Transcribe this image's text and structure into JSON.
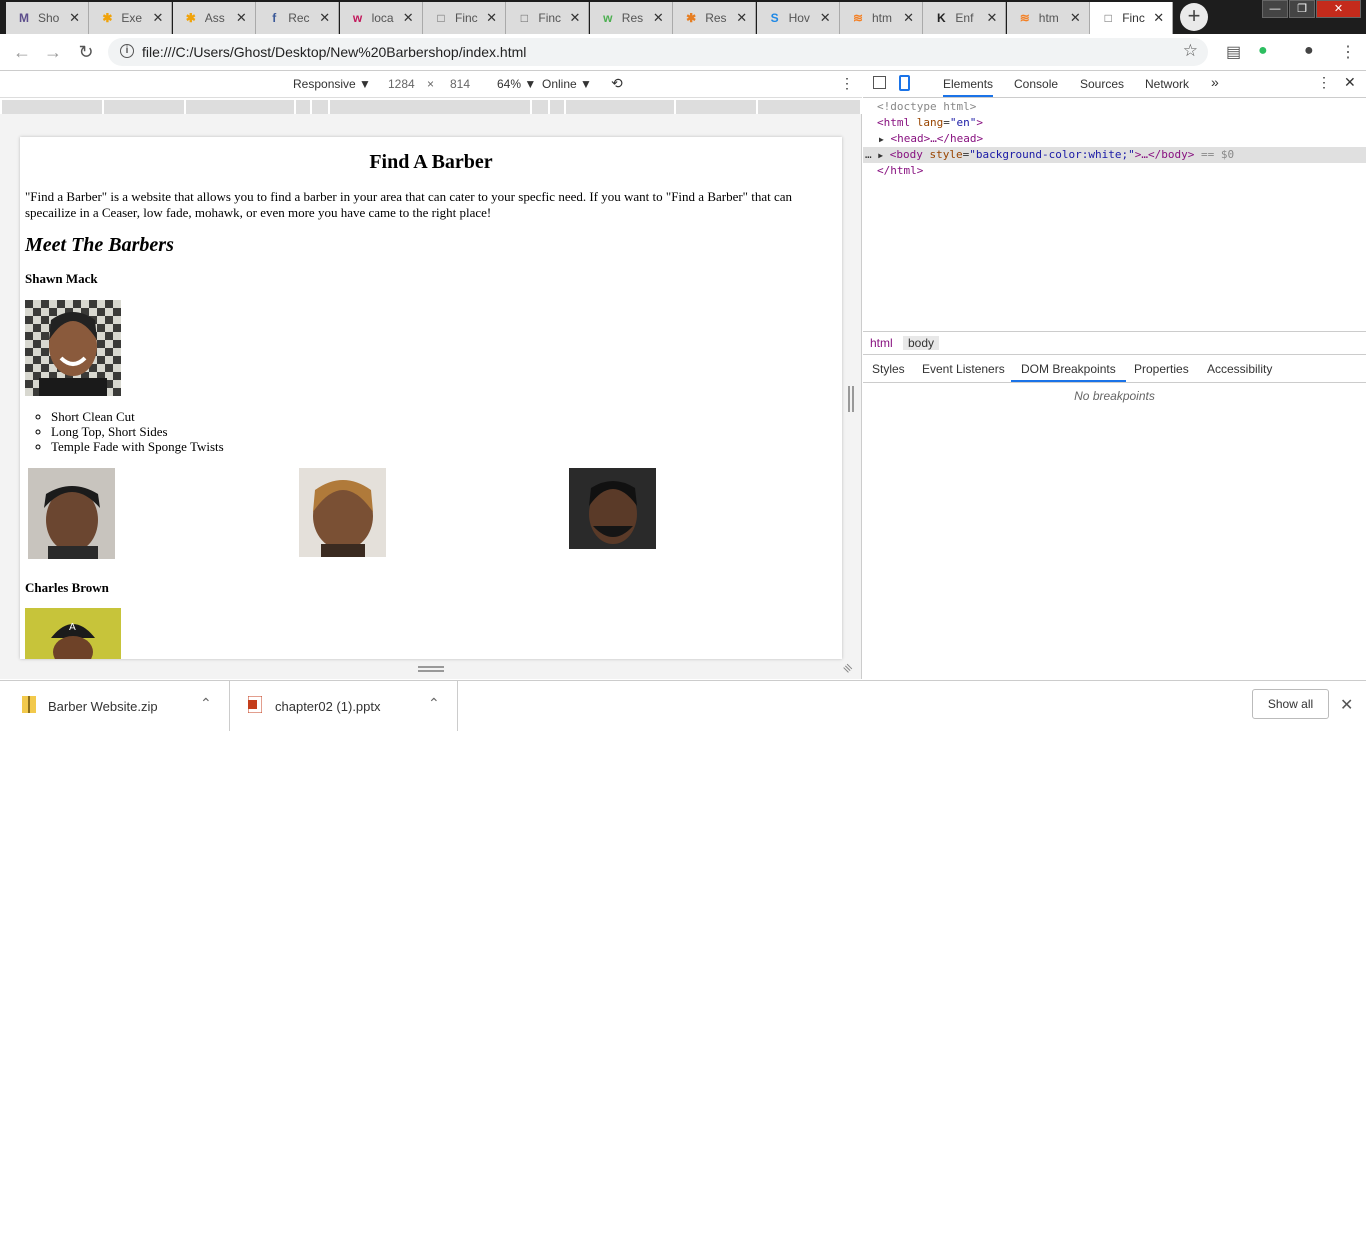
{
  "tabs": [
    {
      "title": "Sho",
      "icon": "M",
      "color": "#5d4e8c",
      "close": "✕"
    },
    {
      "title": "Exe",
      "icon": "✱",
      "color": "#f0a30a",
      "close": "✕"
    },
    {
      "title": "Ass",
      "icon": "✱",
      "color": "#f0a30a",
      "close": "✕"
    },
    {
      "title": "Rec",
      "icon": "f",
      "color": "#3b5998",
      "close": "✕"
    },
    {
      "title": "loca",
      "icon": "w",
      "color": "#c2185b",
      "close": "✕"
    },
    {
      "title": "Finc",
      "icon": "□",
      "color": "#666666",
      "close": "✕"
    },
    {
      "title": "Finc",
      "icon": "□",
      "color": "#666666",
      "close": "✕"
    },
    {
      "title": "Res",
      "icon": "w",
      "color": "#4caf50",
      "close": "✕"
    },
    {
      "title": "Res",
      "icon": "✱",
      "color": "#e67e22",
      "close": "✕"
    },
    {
      "title": "Hov",
      "icon": "S",
      "color": "#1e88e5",
      "close": "✕"
    },
    {
      "title": "htm",
      "icon": "≋",
      "color": "#f48024",
      "close": "✕"
    },
    {
      "title": "Enf",
      "icon": "K",
      "color": "#222222",
      "close": "✕"
    },
    {
      "title": "htm",
      "icon": "≋",
      "color": "#f48024",
      "close": "✕"
    },
    {
      "title": "Finc",
      "icon": "□",
      "color": "#666666",
      "close": "✕",
      "active": true
    }
  ],
  "newtab": "+",
  "window": {
    "minimize": "—",
    "maximize": "❐",
    "close": "✕"
  },
  "address": {
    "url": "file:///C:/Users/Ghost/Desktop/New%20Barbershop/index.html",
    "info": "i",
    "star": "☆",
    "back": "←",
    "forward": "→",
    "reload": "↻",
    "menu": "⋮",
    "profile": "●",
    "reader": "▤",
    "evernote": "●"
  },
  "device_toolbar": {
    "mode": "Responsive ▼",
    "width": "1284",
    "times": "×",
    "height": "814",
    "zoom": "64% ▼",
    "network": "Online ▼",
    "rotate": "⟲",
    "more": "⋮"
  },
  "page": {
    "heading": "Find A Barber",
    "intro": "\"Find a Barber\" is a website that allows you to find a barber in your area that can cater to your specfic need. If you want to \"Find a Barber\" that can specailize in a Ceaser, low fade, mohawk, or even more you have came to the right place!",
    "subheading": "Meet The Barbers",
    "barber1": "Shawn Mack",
    "styles": [
      "Short Clean Cut",
      "Long Top, Short Sides",
      "Temple Fade with Sponge Twists"
    ],
    "barber2": "Charles Brown"
  },
  "devtools": {
    "tabs": [
      "Elements",
      "Console",
      "Sources",
      "Network"
    ],
    "more_tabs": "»",
    "menu": "⋮",
    "close": "✕",
    "code": {
      "doctype": "<!doctype html>",
      "html_open": "<html",
      "lang_attr": "lang",
      "lang_val": "\"en\"",
      "head": "<head>…</head>",
      "body_open": "<body",
      "style_attr": "style",
      "style_val": "\"background-color:white;\"",
      "body_rest": ">…</body>",
      "sel_marker": "== $0",
      "html_close": "</html>",
      "dots": "…",
      "arrow": "▶",
      "gt": ">",
      "eq": "="
    },
    "breadcrumbs": [
      "html",
      "body"
    ],
    "subtabs": [
      "Styles",
      "Event Listeners",
      "DOM Breakpoints",
      "Properties",
      "Accessibility"
    ],
    "empty": "No breakpoints"
  },
  "downloads": {
    "items": [
      "Barber Website.zip",
      "chapter02 (1).pptx"
    ],
    "caret": "⌃",
    "show_all": "Show all",
    "close": "✕"
  }
}
